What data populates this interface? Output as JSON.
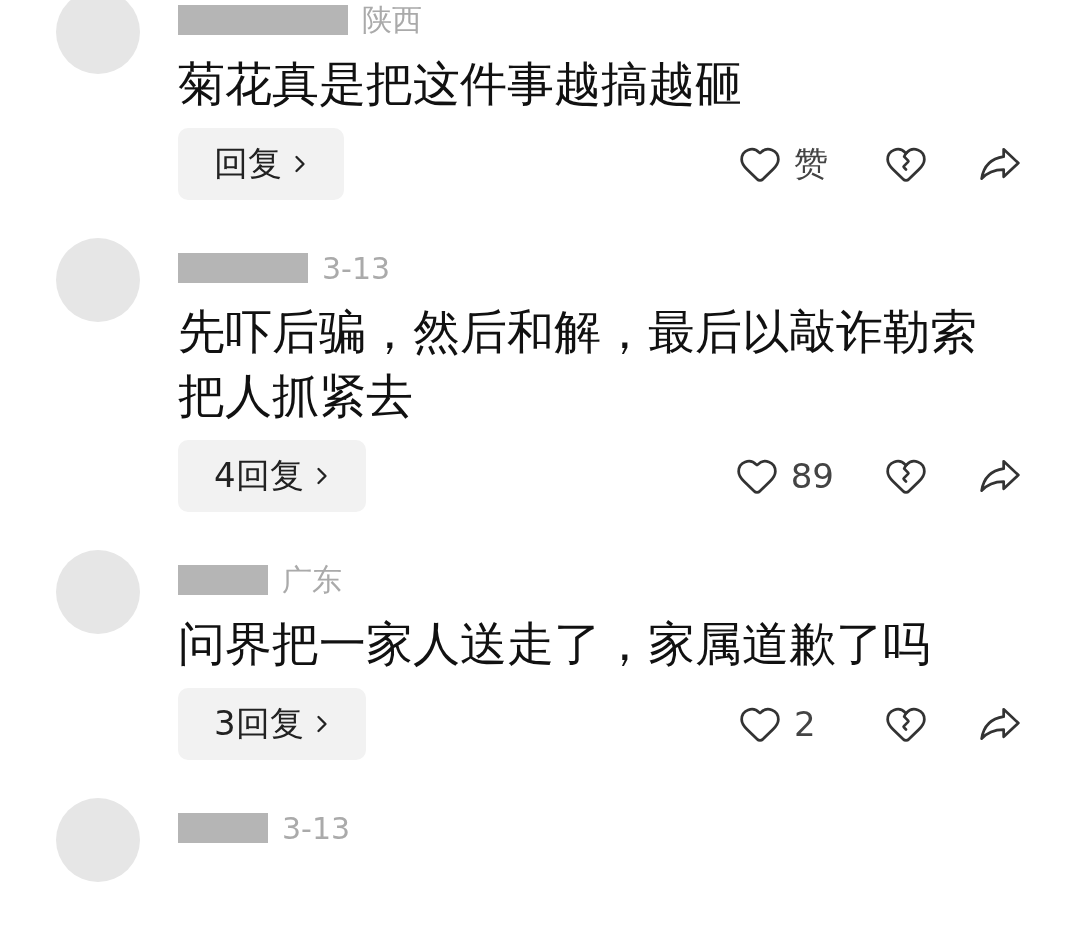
{
  "comments": [
    {
      "meta": "陕西",
      "text": "菊花真是把这件事越搞越砸",
      "reply": "回复",
      "like_label": "赞"
    },
    {
      "meta": "3-13",
      "text": "先吓后骗，然后和解，最后以敲诈勒索把人抓紧去",
      "reply": "4回复",
      "like_label": "89"
    },
    {
      "meta": "广东",
      "text": "问界把一家人送走了，家属道歉了吗",
      "reply": "3回复",
      "like_label": "2"
    },
    {
      "meta": "3-13"
    }
  ]
}
